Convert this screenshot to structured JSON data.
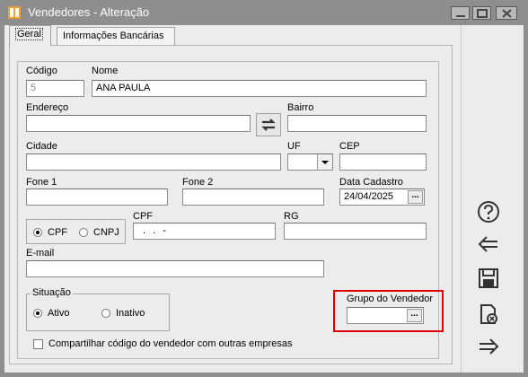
{
  "window": {
    "title": "Vendedores - Alteração"
  },
  "tabs": [
    {
      "label": "Geral"
    },
    {
      "label": "Informações Bancárias"
    }
  ],
  "form": {
    "codigo_label": "Código",
    "codigo_value": "5",
    "nome_label": "Nome",
    "nome_value": "ANA PAULA",
    "endereco_label": "Endereço",
    "bairro_label": "Bairro",
    "cidade_label": "Cidade",
    "uf_label": "UF",
    "cep_label": "CEP",
    "fone1_label": "Fone 1",
    "fone2_label": "Fone 2",
    "data_cadastro_label": "Data Cadastro",
    "data_cadastro_value": "24/04/2025",
    "tipo_cpf_label": "CPF",
    "tipo_cnpj_label": "CNPJ",
    "cpf_label": "CPF",
    "cpf_value": ". . -",
    "rg_label": "RG",
    "email_label": "E-mail",
    "situacao_label": "Situação",
    "ativo_label": "Ativo",
    "inativo_label": "Inativo",
    "grupo_label": "Grupo do Vendedor",
    "ellipsis": "...",
    "compartilhar_label": "Compartilhar código do vendedor com outras empresas"
  },
  "sidebar": {
    "icons": [
      "help-icon",
      "back-arrow-icon",
      "save-icon",
      "delete-icon",
      "forward-arrow-icon"
    ]
  },
  "colors": {
    "highlight": "#e00000",
    "accent": "#d08020"
  }
}
